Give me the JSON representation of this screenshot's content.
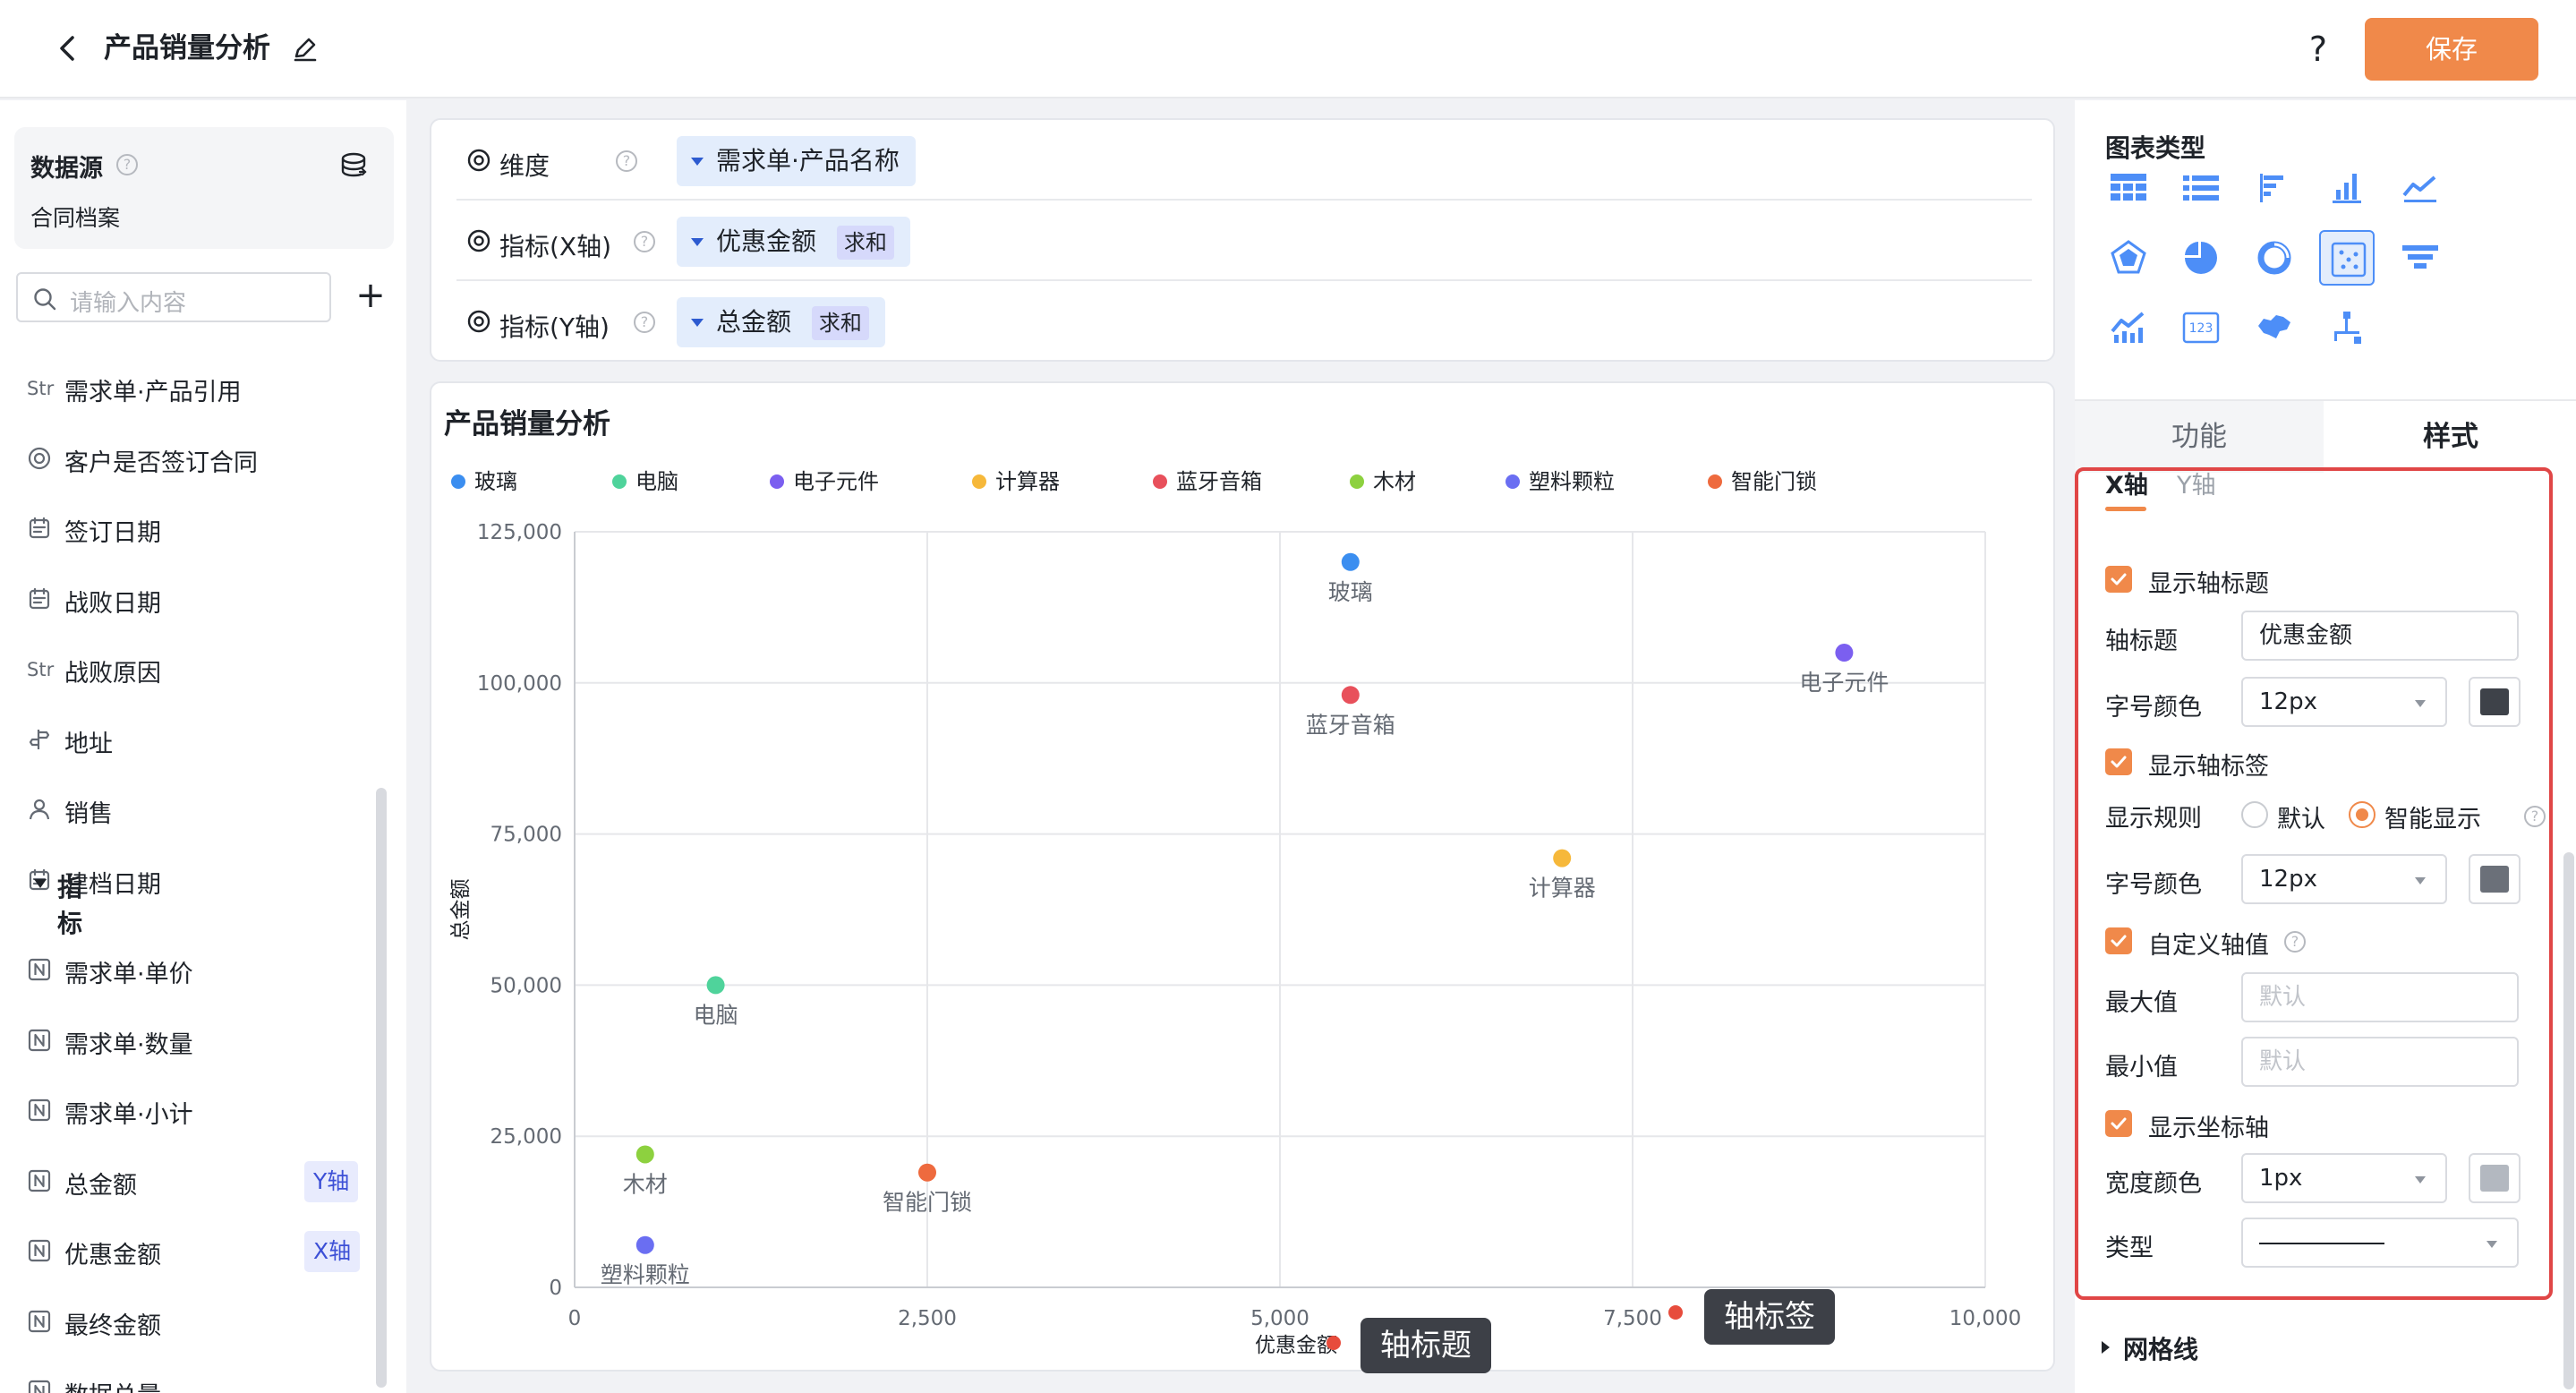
{
  "header": {
    "title": "产品销量分析",
    "help": "?",
    "save_label": "保存"
  },
  "left": {
    "datasource_title": "数据源",
    "datasource_help": "?",
    "datasource_name": "合同档案",
    "search_placeholder": "请输入内容",
    "add": "+",
    "metric_group": "指标",
    "fields": [
      {
        "icon": "Str",
        "label": "需求单·产品引用"
      },
      {
        "icon": "radio",
        "label": "客户是否签订合同"
      },
      {
        "icon": "date",
        "label": "签订日期"
      },
      {
        "icon": "date",
        "label": "战败日期"
      },
      {
        "icon": "Str",
        "label": "战败原因"
      },
      {
        "icon": "address",
        "label": "地址"
      },
      {
        "icon": "user",
        "label": "销售"
      },
      {
        "icon": "date",
        "label": "建档日期"
      }
    ],
    "metrics": [
      {
        "icon": "N",
        "label": "需求单·单价",
        "badge": ""
      },
      {
        "icon": "N",
        "label": "需求单·数量",
        "badge": ""
      },
      {
        "icon": "N",
        "label": "需求单·小计",
        "badge": ""
      },
      {
        "icon": "N",
        "label": "总金额",
        "badge": "Y轴"
      },
      {
        "icon": "N",
        "label": "优惠金额",
        "badge": "X轴"
      },
      {
        "icon": "N",
        "label": "最终金额",
        "badge": ""
      },
      {
        "icon": "N",
        "label": "数据总量",
        "badge": ""
      }
    ]
  },
  "config": {
    "rows": [
      {
        "label": "维度",
        "chip": "需求单·产品名称",
        "agg": ""
      },
      {
        "label": "指标(X轴)",
        "chip": "优惠金额",
        "agg": "求和"
      },
      {
        "label": "指标(Y轴)",
        "chip": "总金额",
        "agg": "求和"
      }
    ],
    "help": "?"
  },
  "chart_data": {
    "type": "scatter",
    "title": "产品销量分析",
    "xlabel": "优惠金额",
    "ylabel": "总金额",
    "xlim": [
      0,
      10000
    ],
    "ylim": [
      0,
      125000
    ],
    "x_ticks": [
      0,
      2500,
      5000,
      7500,
      10000
    ],
    "y_ticks": [
      0,
      25000,
      50000,
      75000,
      100000,
      125000
    ],
    "x_tick_labels": [
      "0",
      "2,500",
      "5,000",
      "7,500",
      "10,000"
    ],
    "y_tick_labels": [
      "0",
      "25,000",
      "50,000",
      "75,000",
      "100,000",
      "125,000"
    ],
    "grid": true,
    "legend_position": "top-left",
    "series": [
      {
        "name": "玻璃",
        "color": "#3b8ef0",
        "x": 5500,
        "y": 120000
      },
      {
        "name": "电脑",
        "color": "#4fd39b",
        "x": 1000,
        "y": 50000
      },
      {
        "name": "电子元件",
        "color": "#7b5ff0",
        "x": 9000,
        "y": 105000
      },
      {
        "name": "计算器",
        "color": "#f6b83a",
        "x": 7000,
        "y": 71000
      },
      {
        "name": "蓝牙音箱",
        "color": "#e8505b",
        "x": 5500,
        "y": 98000
      },
      {
        "name": "木材",
        "color": "#8dd13f",
        "x": 500,
        "y": 22000
      },
      {
        "name": "塑料颗粒",
        "color": "#6a6ef2",
        "x": 500,
        "y": 7000
      },
      {
        "name": "智能门锁",
        "color": "#ee6a3e",
        "x": 2500,
        "y": 19000
      }
    ]
  },
  "annotations": {
    "axis_title_tip": "轴标题",
    "axis_label_tip": "轴标签"
  },
  "right": {
    "chart_type_title": "图表类型",
    "chart_types": [
      "table-icon",
      "list-icon",
      "bar-horizontal-icon",
      "bar-vertical-icon",
      "line-icon",
      "radar-icon",
      "pie-icon",
      "donut-icon",
      "scatter-icon",
      "funnel-icon",
      "combo-icon",
      "number-card-icon",
      "map-icon",
      "tree-icon"
    ],
    "selected_chart_type": "scatter-icon",
    "tab_function": "功能",
    "tab_style": "样式",
    "axis_tab_x": "X轴",
    "axis_tab_y": "Y轴",
    "show_axis_title": "显示轴标题",
    "axis_title_label": "轴标题",
    "axis_title_value": "优惠金额",
    "font_color_label": "字号颜色",
    "font_size_1": "12px",
    "color_1": "#3e4249",
    "show_axis_label": "显示轴标签",
    "display_rule_label": "显示规则",
    "rule_default": "默认",
    "rule_smart": "智能显示",
    "help": "?",
    "font_color_label_2": "字号颜色",
    "font_size_2": "12px",
    "color_2": "#6b7079",
    "custom_axis_value": "自定义轴值",
    "max_label": "最大值",
    "max_placeholder": "默认",
    "min_label": "最小值",
    "min_placeholder": "默认",
    "show_axis_line": "显示坐标轴",
    "width_color_label": "宽度颜色",
    "width_value": "1px",
    "color_3": "#b3b8c0",
    "type_label": "类型",
    "gridline": "网格线"
  }
}
